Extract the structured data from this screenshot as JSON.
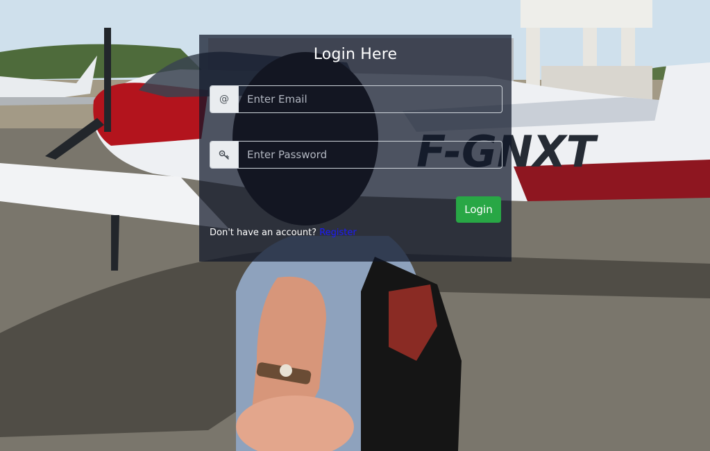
{
  "login": {
    "title": "Login Here",
    "email_icon": "@",
    "email_placeholder": "Enter Email",
    "email_value": "",
    "password_icon": "key-icon",
    "password_placeholder": "Enter Password",
    "password_value": "",
    "login_label": "Login",
    "register_prompt": "Don't have an account?",
    "register_link": "Register"
  },
  "background": {
    "aircraft_registration": "F-GNXT"
  },
  "colors": {
    "panel": "#0f1628",
    "button": "#28a745",
    "link": "#1a1aff",
    "addon": "#e9ecef"
  }
}
